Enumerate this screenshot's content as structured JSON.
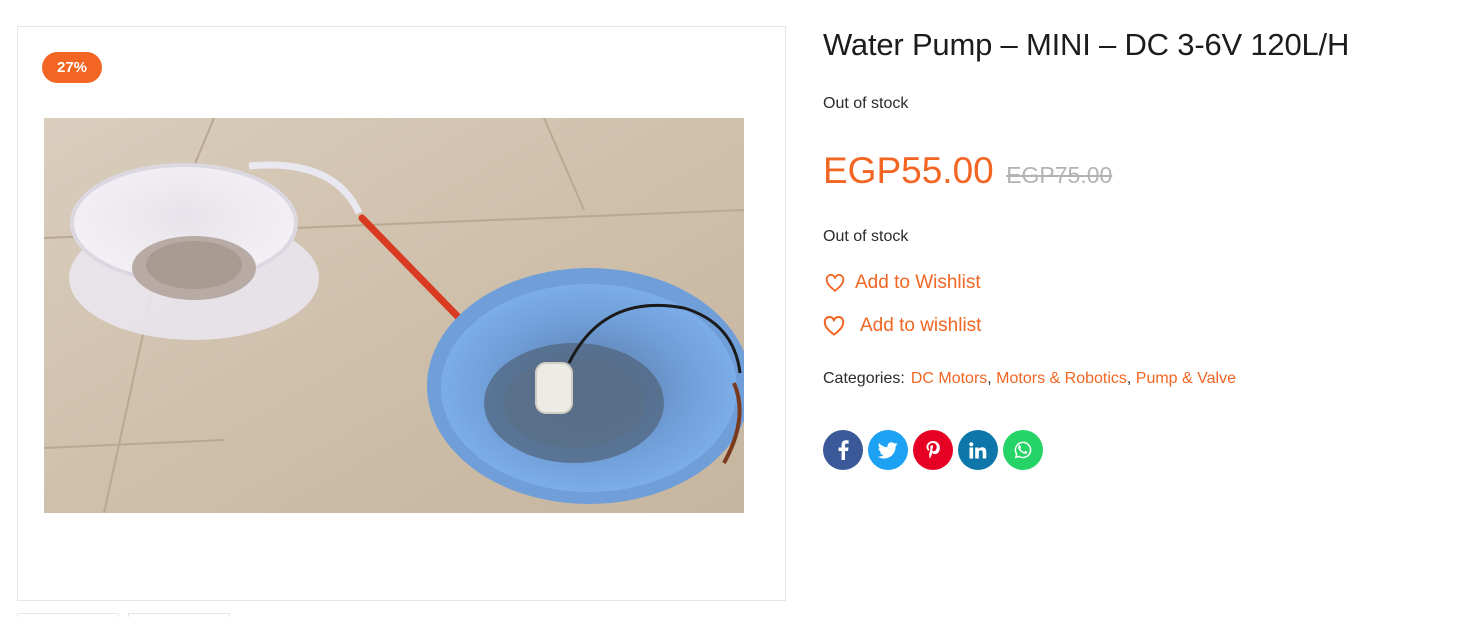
{
  "product": {
    "title": "Water Pump – MINI – DC 3-6V 120L/H",
    "sale_badge": "27%",
    "stock_status_top": "Out of stock",
    "stock_status_bottom": "Out of stock",
    "price_current": "EGP55.00",
    "price_old": "EGP75.00",
    "wishlist_primary": "Add to Wishlist",
    "wishlist_secondary": "Add to wishlist",
    "categories_label": "Categories:",
    "categories": [
      "DC Motors",
      "Motors & Robotics",
      "Pump & Valve"
    ],
    "category_separator": ", "
  },
  "share": [
    {
      "icon": "facebook-icon",
      "color": "#3b5998"
    },
    {
      "icon": "twitter-icon",
      "color": "#1da1f2"
    },
    {
      "icon": "pinterest-icon",
      "color": "#e60023"
    },
    {
      "icon": "linkedin-icon",
      "color": "#0e76a8"
    },
    {
      "icon": "whatsapp-icon",
      "color": "#25d366"
    }
  ],
  "colors": {
    "accent": "#f26522",
    "old_price": "#b3b3b3",
    "text": "#1c1c1c"
  }
}
